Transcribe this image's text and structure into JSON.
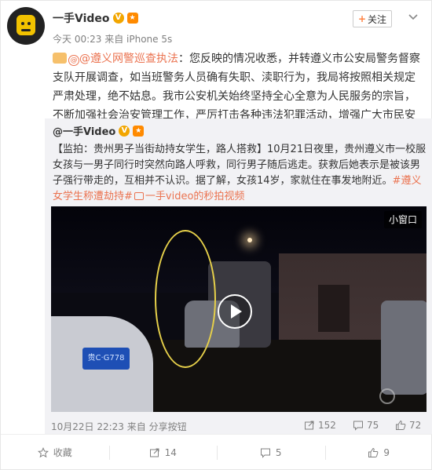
{
  "post": {
    "author": "一手Video",
    "meta": "今天 00:23 来自 iPhone 5s",
    "follow_label": "关注",
    "text_mention": "@遵义网警巡查执法",
    "text_body": "：您反映的情况收悉，并转遵义市公安局警务督察支队开展调查，如当班警务人员确有失职、渎职行为，我局将按照相关规定严肃处理，绝不姑息。我市公安机关始终坚持全心全意为人民服务的宗旨，不断加强社会治安管理工作，严厉打击各种违法犯罪活动，增强广大市民安全感和满意度。"
  },
  "retweet": {
    "author": "@一手Video",
    "text_lead": "【监拍：贵州男子当街劫持女学生，路人搭救】10月21日夜里，贵州遵义市一校服女孩与一男子同行时突然向路人呼救，同行男子随后逃走。获救后她表示是被该男子强行带走的，互相并不认识。据了解，女孩14岁，家就住在事发地附近。",
    "topic": "#遵义女学生称遭劫持#",
    "video_link": "一手video的秒拍视频",
    "mini_window": "小窗口",
    "plate_text": "贵C·G778",
    "time_source": "10月22日 22:23 来自 分享按钮",
    "share_count": "152",
    "comment_count": "75",
    "like_count": "72"
  },
  "actions": {
    "favorite": "收藏",
    "repost": "14",
    "comment": "5",
    "like": "9"
  },
  "colors": {
    "accent": "#eb7350",
    "badge": "#f2a600",
    "retweet_bg": "#f2f2f5"
  }
}
